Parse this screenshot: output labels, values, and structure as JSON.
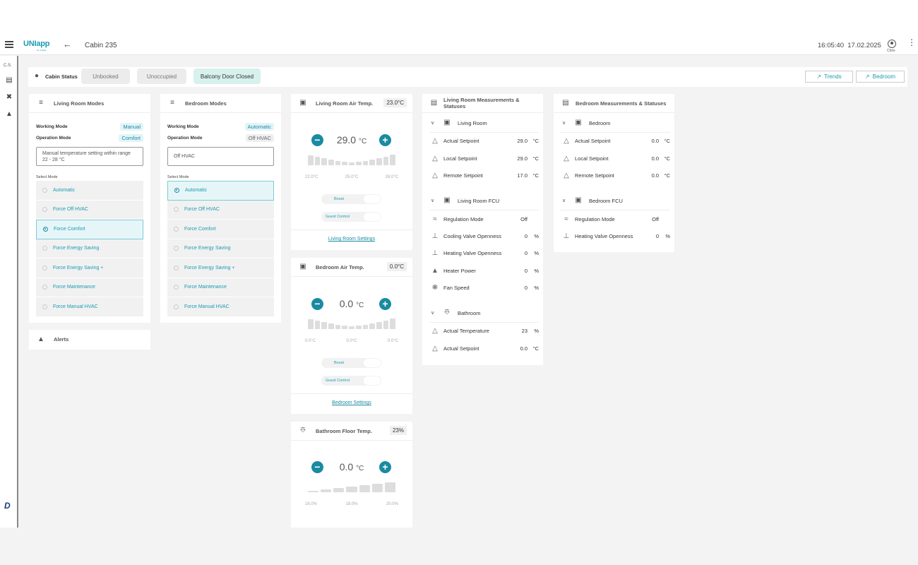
{
  "app": {
    "logo": "UNIapp",
    "logo_sub": "by Uniqair",
    "page_title": "Cabin 235",
    "time": "16:05:40",
    "date": "17.02.2025",
    "user": "Chris"
  },
  "sidebar": {
    "cs": "C.S."
  },
  "status": {
    "label": "Cabin Status",
    "chips": [
      "Unbooked",
      "Unoccupied",
      "Balcony Door Closed"
    ],
    "trends": "Trends",
    "bedroom": "Bedroom"
  },
  "living_modes": {
    "title": "Living Room Modes",
    "working_label": "Working Mode",
    "working_value": "Manual",
    "operation_label": "Operation Mode",
    "operation_value": "Comfort",
    "note_line1": "Manual temperature setting within range",
    "note_line2": "22 - 28 °C",
    "select_label": "Select Mode",
    "options": [
      "Automatic",
      "Force Off HVAC",
      "Force Comfort",
      "Force Energy Saving",
      "Force Energy Saving +",
      "Force Maintenance",
      "Force Manual HVAC"
    ],
    "selected": "Force Comfort"
  },
  "bedroom_modes": {
    "title": "Bedroom Modes",
    "working_label": "Working Mode",
    "working_value": "Automatic",
    "operation_label": "Operation Mode",
    "operation_value": "Off HVAC",
    "note": "Off HVAC",
    "select_label": "Select Mode",
    "options": [
      "Automatic",
      "Force Off HVAC",
      "Force Comfort",
      "Force Energy Saving",
      "Force Energy Saving +",
      "Force Maintenance",
      "Force Manual HVAC"
    ],
    "selected": "Automatic"
  },
  "alerts": {
    "title": "Alerts"
  },
  "living_temp": {
    "title": "Living Room Air Temp.",
    "current": "23.0°C",
    "setpoint": "29.0",
    "unit": "°C",
    "scale": [
      "22.0°C",
      "25.0°C",
      "28.0°C"
    ],
    "boost": "Boost",
    "guest": "Guest Control",
    "link": "Living Room Settings"
  },
  "bedroom_temp": {
    "title": "Bedroom Air Temp.",
    "current": "0.0°C",
    "setpoint": "0.0",
    "unit": "°C",
    "scale": [
      "0.0°C",
      "0.0°C",
      "0.0°C"
    ],
    "boost": "Boost",
    "guest": "Guest Control",
    "link": "Bedroom Settings"
  },
  "floor_temp": {
    "title": "Bathroom Floor Temp.",
    "current": "23%",
    "setpoint": "0.0",
    "unit": "°C",
    "scale": [
      "16.0%",
      "18.0%",
      "20.0%"
    ]
  },
  "living_meas": {
    "title": "Living Room Measurements & Statuses",
    "g1": "Living Room",
    "r1": [
      {
        "label": "Actual Setpoint",
        "value": "29.0",
        "unit": "°C"
      },
      {
        "label": "Local Setpoint",
        "value": "29.0",
        "unit": "°C"
      },
      {
        "label": "Remote Setpoint",
        "value": "17.0",
        "unit": "°C"
      }
    ],
    "g2": "Living Room FCU",
    "r2": [
      {
        "label": "Regulation Mode",
        "value": "Off",
        "unit": ""
      },
      {
        "label": "Cooling Valve Openness",
        "value": "0",
        "unit": "%"
      },
      {
        "label": "Heating Valve Openness",
        "value": "0",
        "unit": "%"
      },
      {
        "label": "Heater Power",
        "value": "0",
        "unit": "%"
      },
      {
        "label": "Fan Speed",
        "value": "0",
        "unit": "%"
      }
    ],
    "g3": "Bathroom",
    "r3": [
      {
        "label": "Actual Temperature",
        "value": "23",
        "unit": "%"
      },
      {
        "label": "Actual Setpoint",
        "value": "0.0",
        "unit": "°C"
      }
    ]
  },
  "bed_meas": {
    "title": "Bedroom Measurements & Statuses",
    "g1": "Bedroom",
    "r1": [
      {
        "label": "Actual Setpoint",
        "value": "0.0",
        "unit": "°C"
      },
      {
        "label": "Local Setpoint",
        "value": "0.0",
        "unit": "°C"
      },
      {
        "label": "Remote Setpoint",
        "value": "0.0",
        "unit": "°C"
      }
    ],
    "g2": "Bedroom FCU",
    "r2": [
      {
        "label": "Regulation Mode",
        "value": "Off",
        "unit": ""
      },
      {
        "label": "Heating Valve Openness",
        "value": "0",
        "unit": "%"
      }
    ]
  }
}
